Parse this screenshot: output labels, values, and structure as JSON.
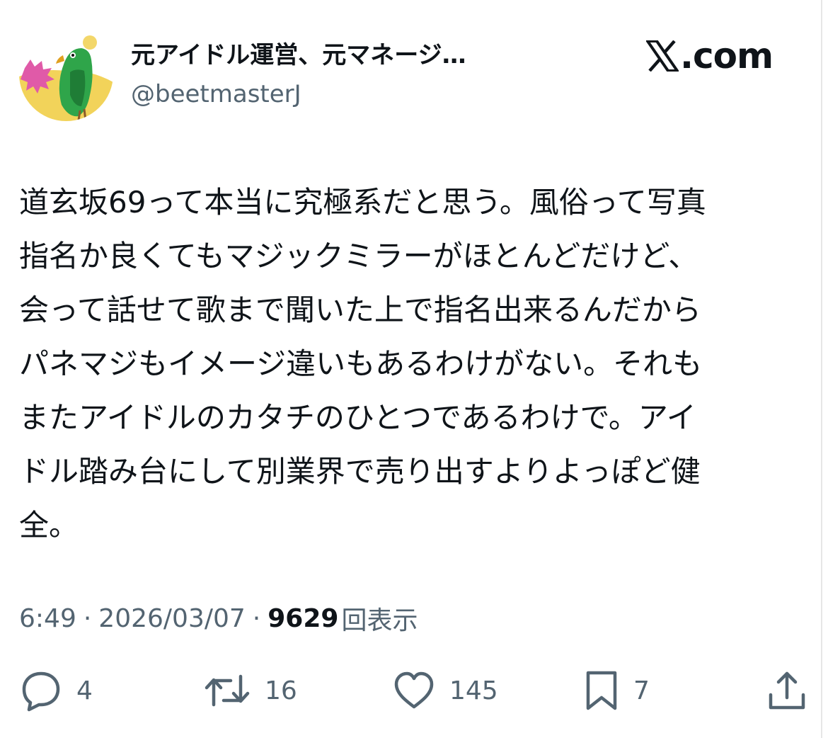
{
  "header": {
    "display_name": "元アイドル運営、元マネージ…",
    "handle": "@beetmasterJ",
    "brand": {
      "mark": "𝕏",
      "suffix": ".com"
    }
  },
  "tweet": {
    "text": "道玄坂69って本当に究極系だと思う。風俗って写真\n指名か良くてもマジックミラーがほとんどだけど、\n会って話せて歌まで聞いた上で指名出来るんだから\nパネマジもイメージ違いもあるわけがない。それも\nまたアイドルのカタチのひとつであるわけで。アイ\nドル踏み台にして別業界で売り出すよりよっぽど健\n全。"
  },
  "meta": {
    "time": "6:49",
    "date": "2026/03/07",
    "views_count": "9629",
    "views_label": "回表示",
    "separator": "·"
  },
  "actions": {
    "replies": "4",
    "retweets": "16",
    "likes": "145",
    "bookmarks": "7"
  },
  "icons": {
    "avatar": "green-parrot-avatar",
    "reply": "speech-bubble-icon",
    "retweet": "retweet-arrows-icon",
    "like": "heart-icon",
    "bookmark": "bookmark-icon",
    "share": "share-upload-icon"
  },
  "colors": {
    "text": "#0f1419",
    "secondary": "#536471",
    "background": "#ffffff"
  }
}
